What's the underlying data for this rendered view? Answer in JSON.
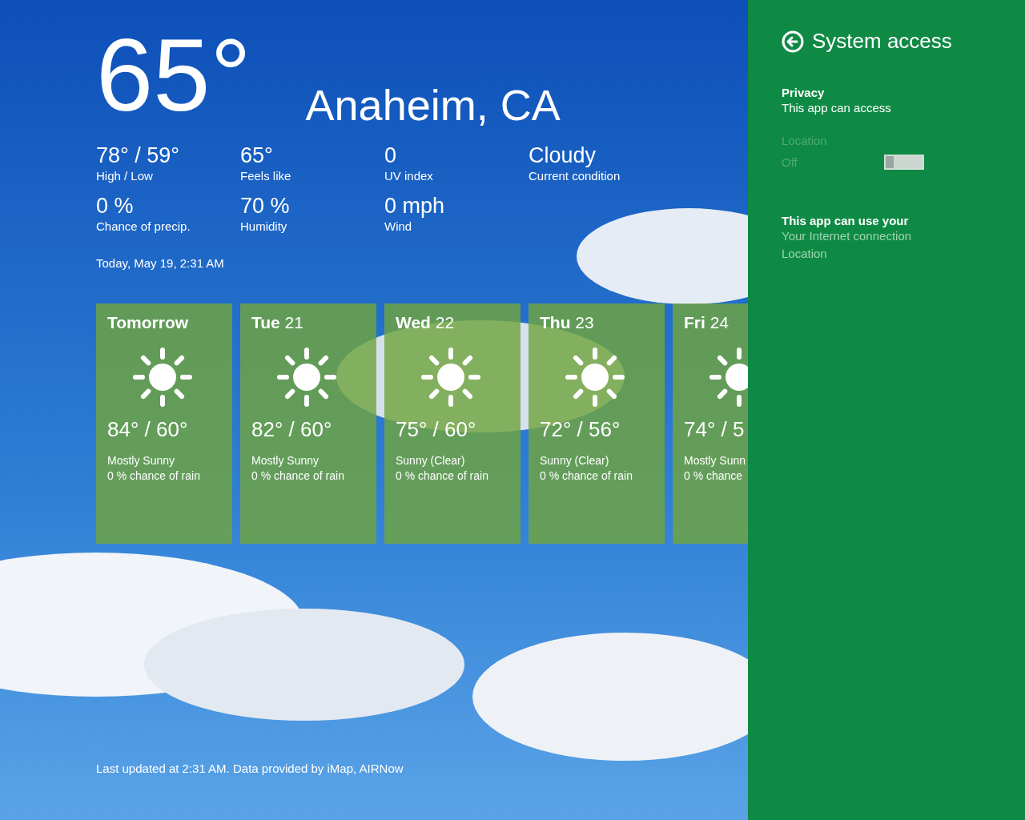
{
  "current": {
    "temperature": "65°",
    "city": "Anaheim, CA"
  },
  "stats": [
    {
      "value": "78° / 59°",
      "label": "High / Low"
    },
    {
      "value": "65°",
      "label": "Feels like"
    },
    {
      "value": "0",
      "label": "UV index"
    },
    {
      "value": "Cloudy",
      "label": "Current condition"
    },
    {
      "value": "0 %",
      "label": "Chance of precip."
    },
    {
      "value": "70 %",
      "label": "Humidity"
    },
    {
      "value": "0 mph",
      "label": "Wind"
    }
  ],
  "timestamp": "Today, May 19, 2:31 AM",
  "forecast": [
    {
      "day": "Tomorrow",
      "temps": "84° / 60°",
      "condition": "Mostly Sunny",
      "rain": "0 % chance of rain"
    },
    {
      "day": "Tue",
      "date": "21",
      "temps": "82° / 60°",
      "condition": "Mostly Sunny",
      "rain": "0 % chance of rain"
    },
    {
      "day": "Wed",
      "date": "22",
      "temps": "75° / 60°",
      "condition": "Sunny (Clear)",
      "rain": "0 % chance of rain"
    },
    {
      "day": "Thu",
      "date": "23",
      "temps": "72° / 56°",
      "condition": "Sunny (Clear)",
      "rain": "0 % chance of rain"
    },
    {
      "day": "Fri",
      "date": "24",
      "temps": "74° / 5",
      "condition": "Mostly Sunn",
      "rain": "0 % chance"
    }
  ],
  "footer": "Last updated at 2:31 AM. Data provided by iMap, AIRNow",
  "panel": {
    "title": "System access",
    "privacy": {
      "heading": "Privacy",
      "subtitle": "This app can access",
      "location": {
        "label": "Location",
        "state_text": "Off",
        "on": false,
        "disabled": true
      }
    },
    "uses": {
      "heading": "This app can use your",
      "items": [
        "Your Internet connection",
        "Location"
      ]
    }
  }
}
